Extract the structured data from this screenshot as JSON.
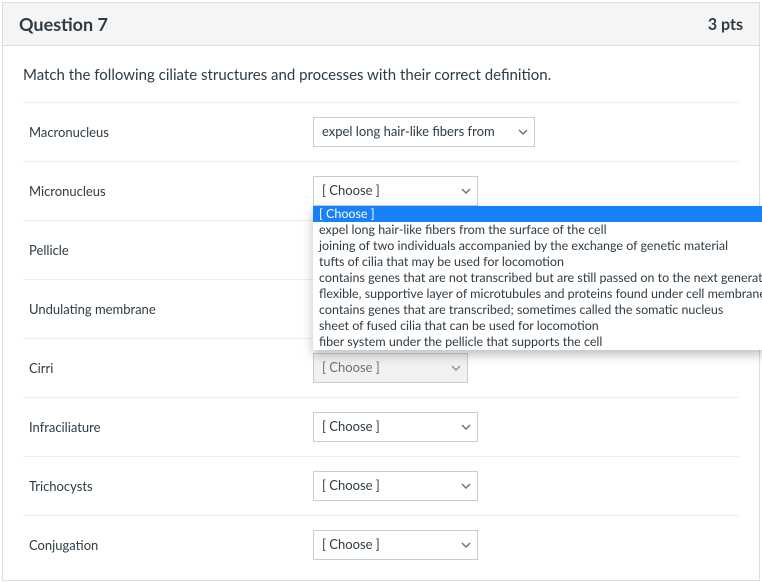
{
  "header": {
    "title": "Question 7",
    "points": "3 pts"
  },
  "prompt": "Match the following ciliate structures and processes with their correct definition.",
  "choose_placeholder": "[ Choose ]",
  "rows": [
    {
      "label": "Macronucleus",
      "selected": "expel long hair-like fibers from"
    },
    {
      "label": "Micronucleus",
      "selected": "[ Choose ]"
    },
    {
      "label": "Pellicle",
      "selected": ""
    },
    {
      "label": "Undulating membrane",
      "selected": ""
    },
    {
      "label": "Cirri",
      "selected": "[ Choose ]"
    },
    {
      "label": "Infraciliature",
      "selected": "[ Choose ]"
    },
    {
      "label": "Trichocysts",
      "selected": "[ Choose ]"
    },
    {
      "label": "Conjugation",
      "selected": "[ Choose ]"
    }
  ],
  "options": [
    "[ Choose ]",
    "expel long hair-like fibers from the surface of the cell",
    "joining of two individuals accompanied by the exchange of genetic material",
    "tufts of cilia that may be used for locomotion",
    "contains genes that are not transcribed but are still passed on to the next generation; somet",
    "flexible, supportive layer of microtubules and proteins found under cell membrane",
    "contains genes that are transcribed; sometimes called the somatic nucleus",
    "sheet of fused cilia that can be used for locomotion",
    "fiber system under the pellicle that supports the cell"
  ]
}
